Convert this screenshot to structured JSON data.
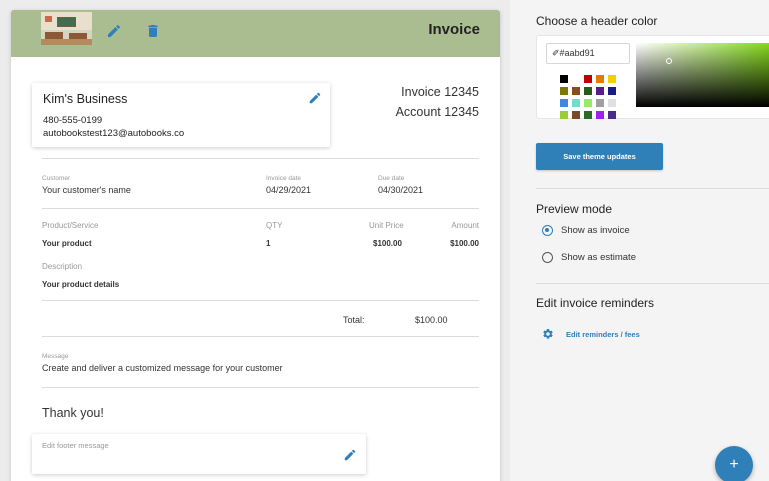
{
  "invoice": {
    "header_color": "#aabd91",
    "title": "Invoice",
    "business": {
      "name": "Kim's Business",
      "phone": "480-555-0199",
      "email": "autobookstest123@autobooks.co"
    },
    "invoice_number": "Invoice 12345",
    "account_number": "Account 12345",
    "customer": {
      "label": "Customer",
      "value": "Your customer's name"
    },
    "invoice_date": {
      "label": "Invoice date",
      "value": "04/29/2021"
    },
    "due_date": {
      "label": "Due date",
      "value": "04/30/2021"
    },
    "columns": {
      "product": "Product/Service",
      "qty": "QTY",
      "unit_price": "Unit Price",
      "amount": "Amount"
    },
    "line_item": {
      "product": "Your product",
      "qty": "1",
      "unit_price": "$100.00",
      "amount": "$100.00"
    },
    "description": {
      "label": "Description",
      "value": "Your product details"
    },
    "total": {
      "label": "Total:",
      "value": "$100.00"
    },
    "message": {
      "label": "Message",
      "value": "Create and deliver a customized message for your customer"
    },
    "thank_you": "Thank you!",
    "footer": {
      "placeholder": "Edit footer message"
    }
  },
  "panel": {
    "header_color_title": "Choose a header color",
    "hex_value": "#aabd91",
    "swatches": [
      "#000000",
      "#ffffff",
      "#c00000",
      "#e87a00",
      "#f5d000",
      "#7a7a00",
      "#8a4a1a",
      "#2a5a1a",
      "#5a1a8a",
      "#1a1a8a",
      "#3a8ae0",
      "#6ae0d0",
      "#9aea6a",
      "#a0a0a0",
      "#e0e0e0",
      "#9acd32",
      "#7a4a2a",
      "#2a6a2a",
      "#a020f0",
      "#4a2a8a"
    ],
    "save_button": "Save theme updates",
    "preview_title": "Preview mode",
    "preview_options": [
      {
        "label": "Show as invoice",
        "selected": true
      },
      {
        "label": "Show as estimate",
        "selected": false
      }
    ],
    "reminders_title": "Edit invoice reminders",
    "reminders_link": "Edit reminders / fees",
    "fab_label": "+",
    "accent": "#2f7fb8"
  }
}
